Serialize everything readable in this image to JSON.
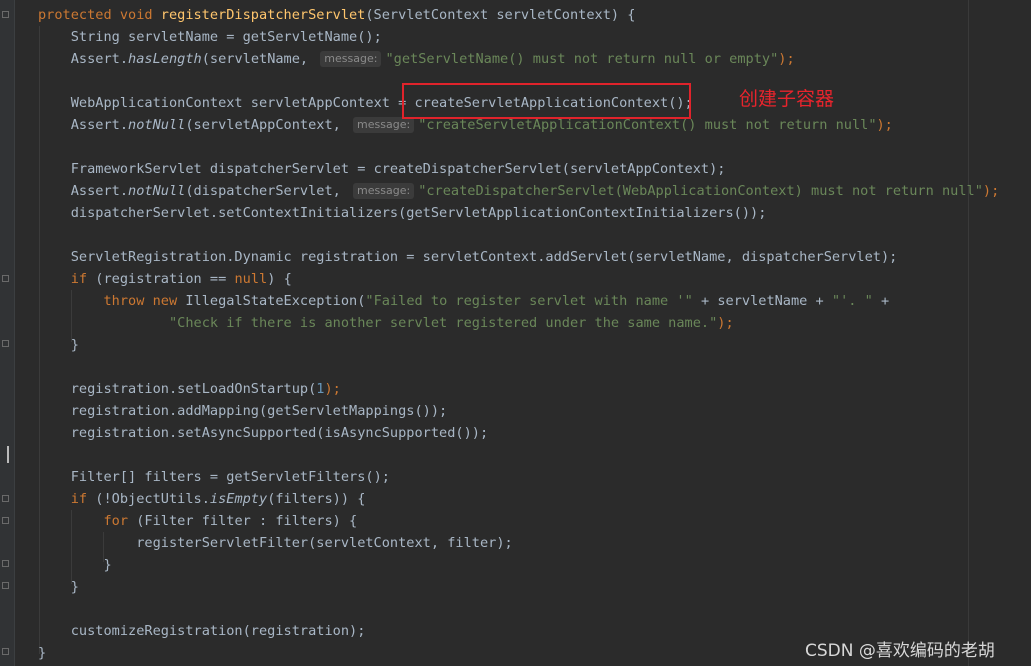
{
  "code": {
    "sig_modifiers": "protected void ",
    "sig_method": "registerDispatcherServlet",
    "sig_params": "(ServletContext servletContext) {",
    "l2": "String servletName = getServletName();",
    "l3_a": "Assert.",
    "l3_b": "hasLength",
    "l3_c": "(servletName, ",
    "l3_hint": "message:",
    "l3_str": "\"getServletName() must not return null or empty\"",
    "l3_end": ");",
    "l5_a": "WebApplicationContext servletAppContext = ",
    "l5_b": "createServletApplicationContext();",
    "l6_a": "Assert.",
    "l6_b": "notNull",
    "l6_c": "(servletAppContext, ",
    "l6_hint": "message:",
    "l6_str": "\"createServletApplicationContext() must not return null\"",
    "l6_end": ");",
    "l8": "FrameworkServlet dispatcherServlet = createDispatcherServlet(servletAppContext);",
    "l9_a": "Assert.",
    "l9_b": "notNull",
    "l9_c": "(dispatcherServlet, ",
    "l9_hint": "message:",
    "l9_str": "\"createDispatcherServlet(WebApplicationContext) must not return null\"",
    "l9_end": ");",
    "l10": "dispatcherServlet.setContextInitializers(getServletApplicationContextInitializers());",
    "l12": "ServletRegistration.Dynamic registration = servletContext.addServlet(servletName, dispatcherServlet);",
    "l13_kw": "if",
    "l13_a": " (registration == ",
    "l13_null": "null",
    "l13_b": ") {",
    "l14_kw1": "throw",
    "l14_kw2": "new",
    "l14_a": " IllegalStateException(",
    "l14_str1": "\"Failed to register servlet with name '\"",
    "l14_b": " + servletName + ",
    "l14_str2": "\"'. \"",
    "l14_c": " +",
    "l15_str": "\"Check if there is another servlet registered under the same name.\"",
    "l15_end": ");",
    "l16": "}",
    "l18_a": "registration.setLoadOnStartup(",
    "l18_num": "1",
    "l18_end": ");",
    "l19": "registration.addMapping(getServletMappings());",
    "l20": "registration.setAsyncSupported(isAsyncSupported());",
    "l22": "Filter[] filters = getServletFilters();",
    "l23_kw": "if",
    "l23_a": " (!ObjectUtils.",
    "l23_b": "isEmpty",
    "l23_c": "(filters)) {",
    "l24_kw": "for",
    "l24_a": " (Filter filter : filters) {",
    "l25": "registerServletFilter(servletContext, filter);",
    "l26": "}",
    "l27": "}",
    "l29": "customizeRegistration(registration);",
    "l30": "}"
  },
  "annotation_text": "创建子容器",
  "watermark": "CSDN @喜欢编码的老胡",
  "colors": {
    "background": "#2b2b2b",
    "text": "#a9b7c6",
    "keyword": "#cc7832",
    "method_decl": "#ffc66d",
    "string": "#6a8759",
    "number": "#6897bb",
    "highlight_box": "#e0232b"
  },
  "icons": [
    "fold-marker-icon"
  ]
}
